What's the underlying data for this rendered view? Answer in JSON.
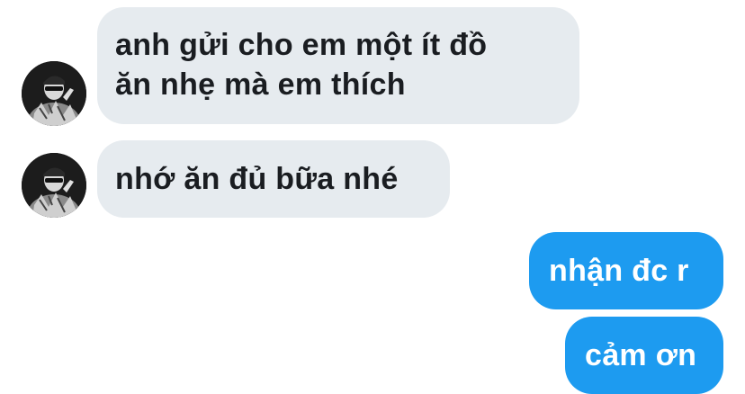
{
  "conversation": {
    "messages": [
      {
        "direction": "incoming",
        "lines": [
          "anh gửi cho em một ít đồ",
          "ăn nhẹ mà em thích"
        ]
      },
      {
        "direction": "incoming",
        "text": "nhớ ăn đủ bữa nhé"
      },
      {
        "direction": "outgoing",
        "text": "nhận đc r"
      },
      {
        "direction": "outgoing",
        "text": "cảm ơn"
      }
    ]
  },
  "colors": {
    "incoming_bubble": "#e6ebef",
    "incoming_text": "#1a1d21",
    "outgoing_bubble": "#1d9bf0",
    "outgoing_text": "#ffffff"
  },
  "icons": {
    "sender_avatar": "profile-photo-avatar"
  }
}
